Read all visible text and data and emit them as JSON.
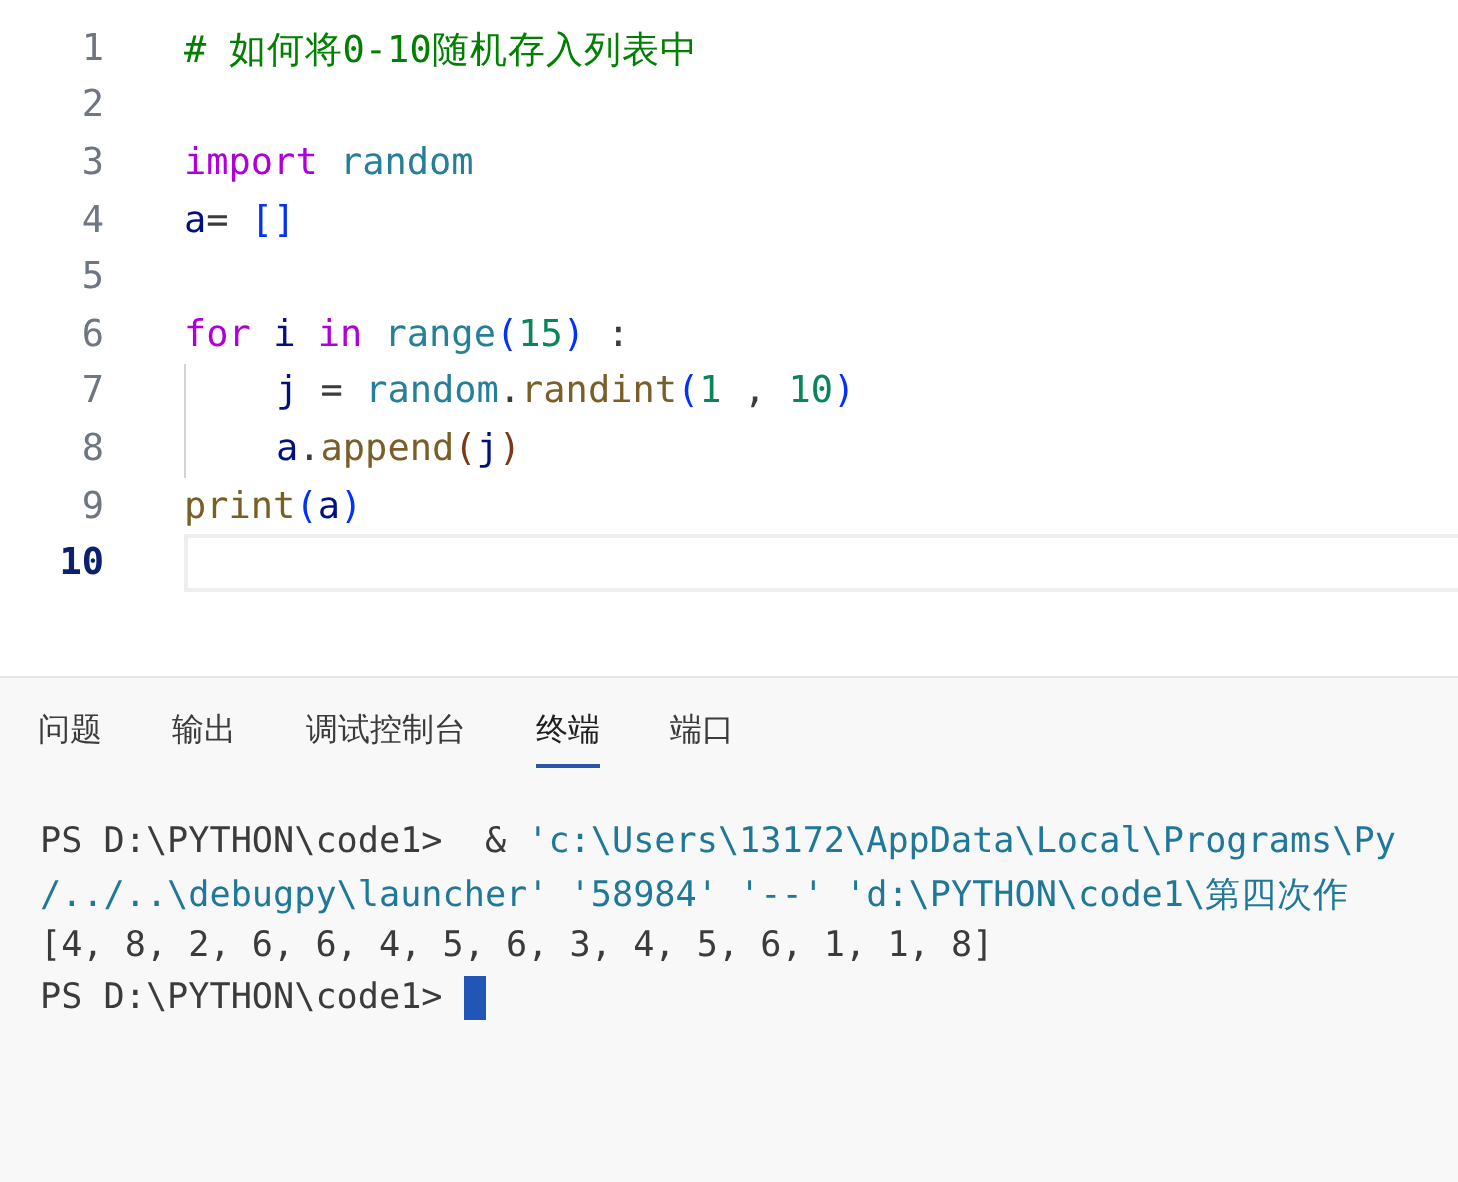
{
  "editor": {
    "lines": [
      {
        "number": "1",
        "current": false,
        "indented": false,
        "tokens": [
          {
            "kind": "comment",
            "text": "# 如何将0-10随机存入列表中"
          }
        ]
      },
      {
        "number": "2",
        "current": false,
        "indented": false
      },
      {
        "number": "3",
        "current": false,
        "indented": false,
        "tokens": [
          {
            "kind": "keyword",
            "text": "import "
          },
          {
            "kind": "module",
            "text": "random"
          }
        ]
      },
      {
        "number": "4",
        "current": false,
        "indented": false,
        "tokens": [
          {
            "kind": "var",
            "text": "a"
          },
          {
            "kind": "plain",
            "text": "= "
          },
          {
            "kind": "bracket",
            "text": "[]"
          }
        ]
      },
      {
        "number": "5",
        "current": false,
        "indented": false
      },
      {
        "number": "6",
        "current": false,
        "indented": false,
        "tokens": [
          {
            "kind": "keyword",
            "text": "for "
          },
          {
            "kind": "var",
            "text": "i "
          },
          {
            "kind": "keyword",
            "text": "in "
          },
          {
            "kind": "module",
            "text": "range"
          },
          {
            "kind": "bracket",
            "text": "("
          },
          {
            "kind": "num",
            "text": "15"
          },
          {
            "kind": "bracket",
            "text": ")"
          },
          {
            "kind": "plain",
            "text": " :"
          }
        ]
      },
      {
        "number": "7",
        "current": false,
        "indented": true,
        "tokens": [
          {
            "kind": "var",
            "text": "j"
          },
          {
            "kind": "plain",
            "text": " = "
          },
          {
            "kind": "module",
            "text": "random"
          },
          {
            "kind": "plain",
            "text": "."
          },
          {
            "kind": "func",
            "text": "randint"
          },
          {
            "kind": "bracket",
            "text": "("
          },
          {
            "kind": "num",
            "text": "1"
          },
          {
            "kind": "plain",
            "text": " , "
          },
          {
            "kind": "num",
            "text": "10"
          },
          {
            "kind": "bracket",
            "text": ")"
          }
        ]
      },
      {
        "number": "8",
        "current": false,
        "indented": true,
        "tokens": [
          {
            "kind": "var",
            "text": "a"
          },
          {
            "kind": "plain",
            "text": "."
          },
          {
            "kind": "func",
            "text": "append"
          },
          {
            "kind": "bracket2",
            "text": "("
          },
          {
            "kind": "var",
            "text": "j"
          },
          {
            "kind": "bracket2",
            "text": ")"
          }
        ]
      },
      {
        "number": "9",
        "current": false,
        "indented": false,
        "tokens": [
          {
            "kind": "func",
            "text": "print"
          },
          {
            "kind": "bracket",
            "text": "("
          },
          {
            "kind": "var",
            "text": "a"
          },
          {
            "kind": "bracket",
            "text": ")"
          }
        ]
      },
      {
        "number": "10",
        "current": true,
        "indented": false
      }
    ]
  },
  "panel": {
    "tabs": [
      {
        "label": "问题",
        "selected": false
      },
      {
        "label": "输出",
        "selected": false
      },
      {
        "label": "调试控制台",
        "selected": false
      },
      {
        "label": "终端",
        "selected": true
      },
      {
        "label": "端口",
        "selected": false
      }
    ]
  },
  "terminal": {
    "lines": [
      {
        "tokens": [
          {
            "kind": "plain",
            "text": "PS D:\\PYTHON\\code1>  & "
          },
          {
            "kind": "string",
            "text": "'c:\\Users\\13172\\AppData\\Local\\Programs\\Py"
          }
        ]
      },
      {
        "tokens": [
          {
            "kind": "string",
            "text": "/../..\\debugpy\\launcher' '58984' '--' 'd:\\PYTHON\\code1\\第四次作"
          }
        ]
      },
      {
        "tokens": [
          {
            "kind": "plain",
            "text": "[4, 8, 2, 6, 6, 4, 5, 6, 3, 4, 5, 6, 1, 1, 8]"
          }
        ]
      },
      {
        "tokens": [
          {
            "kind": "plain",
            "text": "PS D:\\PYTHON\\code1> "
          }
        ],
        "cursor": true
      }
    ]
  }
}
